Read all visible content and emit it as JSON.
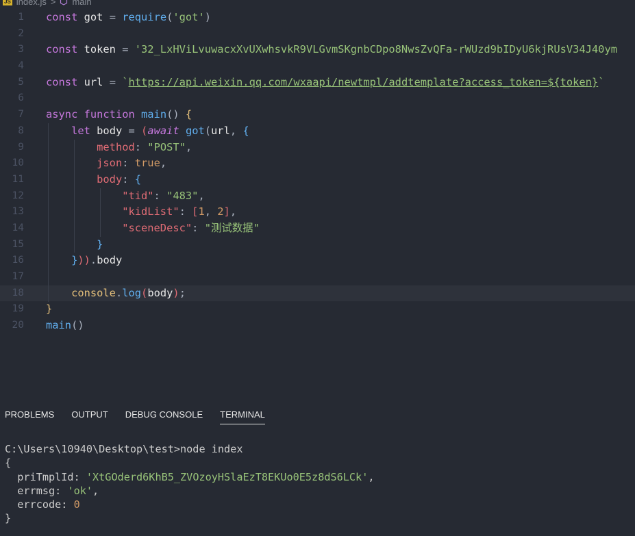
{
  "breadcrumb": {
    "file": "index.js",
    "symbol": "main",
    "separator": ">"
  },
  "editor": {
    "lines": [
      {
        "n": "1",
        "tokens": [
          [
            "k",
            "const "
          ],
          [
            "v",
            "got "
          ],
          [
            "p",
            "= "
          ],
          [
            "f",
            "require"
          ],
          [
            "p",
            "("
          ],
          [
            "s",
            "'got'"
          ],
          [
            "p",
            ")"
          ]
        ]
      },
      {
        "n": "2",
        "tokens": []
      },
      {
        "n": "3",
        "tokens": [
          [
            "k",
            "const "
          ],
          [
            "v",
            "token "
          ],
          [
            "p",
            "= "
          ],
          [
            "s",
            "'32_LxHViLvuwacxXvUXwhsvkR9VLGvmSKgnbCDpo8NwsZvQFa-rWUzd9bIDyU6kjRUsV34J40ym"
          ]
        ]
      },
      {
        "n": "4",
        "tokens": []
      },
      {
        "n": "5",
        "tokens": [
          [
            "k",
            "const "
          ],
          [
            "v",
            "url "
          ],
          [
            "p",
            "= "
          ],
          [
            "s",
            "`"
          ],
          [
            "url",
            "https://api.weixin.qq.com/wxaapi/newtmpl/addtemplate?access_token=${token}"
          ],
          [
            "s",
            "`"
          ]
        ]
      },
      {
        "n": "6",
        "tokens": []
      },
      {
        "n": "7",
        "tokens": [
          [
            "k",
            "async "
          ],
          [
            "k",
            "function "
          ],
          [
            "f",
            "main"
          ],
          [
            "p",
            "() "
          ],
          [
            "y",
            "{"
          ]
        ]
      },
      {
        "n": "8",
        "tokens": [
          [
            "p",
            "    "
          ],
          [
            "k",
            "let "
          ],
          [
            "v",
            "body "
          ],
          [
            "p",
            "= "
          ],
          [
            "pr",
            "("
          ],
          [
            "k it",
            "await "
          ],
          [
            "f",
            "got"
          ],
          [
            "p",
            "("
          ],
          [
            "v",
            "url"
          ],
          [
            "p",
            ", "
          ],
          [
            "f",
            "{"
          ]
        ]
      },
      {
        "n": "9",
        "tokens": [
          [
            "p",
            "        "
          ],
          [
            "pr",
            "method"
          ],
          [
            "p",
            ": "
          ],
          [
            "s",
            "\"POST\""
          ],
          [
            "p",
            ","
          ]
        ]
      },
      {
        "n": "10",
        "tokens": [
          [
            "p",
            "        "
          ],
          [
            "pr",
            "json"
          ],
          [
            "p",
            ": "
          ],
          [
            "n",
            "true"
          ],
          [
            "p",
            ","
          ]
        ]
      },
      {
        "n": "11",
        "tokens": [
          [
            "p",
            "        "
          ],
          [
            "pr",
            "body"
          ],
          [
            "p",
            ": "
          ],
          [
            "f",
            "{"
          ]
        ]
      },
      {
        "n": "12",
        "tokens": [
          [
            "p",
            "            "
          ],
          [
            "pr",
            "\"tid\""
          ],
          [
            "p",
            ": "
          ],
          [
            "s",
            "\"483\""
          ],
          [
            "p",
            ","
          ]
        ]
      },
      {
        "n": "13",
        "tokens": [
          [
            "p",
            "            "
          ],
          [
            "pr",
            "\"kidList\""
          ],
          [
            "p",
            ": "
          ],
          [
            "pr",
            "["
          ],
          [
            "n",
            "1"
          ],
          [
            "p",
            ", "
          ],
          [
            "n",
            "2"
          ],
          [
            "pr",
            "]"
          ],
          [
            "p",
            ","
          ]
        ]
      },
      {
        "n": "14",
        "tokens": [
          [
            "p",
            "            "
          ],
          [
            "pr",
            "\"sceneDesc\""
          ],
          [
            "p",
            ": "
          ],
          [
            "s",
            "\"测试数据\""
          ]
        ]
      },
      {
        "n": "15",
        "tokens": [
          [
            "p",
            "        "
          ],
          [
            "f",
            "}"
          ]
        ]
      },
      {
        "n": "16",
        "tokens": [
          [
            "p",
            "    "
          ],
          [
            "f",
            "}"
          ],
          [
            "pr",
            "))"
          ],
          [
            "p",
            "."
          ],
          [
            "v",
            "body"
          ]
        ]
      },
      {
        "n": "17",
        "tokens": []
      },
      {
        "n": "18",
        "tokens": [
          [
            "p",
            "    "
          ],
          [
            "y",
            "console"
          ],
          [
            "p",
            "."
          ],
          [
            "f",
            "log"
          ],
          [
            "pr",
            "("
          ],
          [
            "v",
            "body"
          ],
          [
            "pr",
            ")"
          ],
          [
            "p",
            ";"
          ]
        ]
      },
      {
        "n": "19",
        "tokens": [
          [
            "y",
            "}"
          ]
        ]
      },
      {
        "n": "20",
        "tokens": [
          [
            "f",
            "main"
          ],
          [
            "p",
            "()"
          ]
        ]
      }
    ]
  },
  "panel": {
    "tabs": [
      {
        "label": "PROBLEMS",
        "active": false
      },
      {
        "label": "OUTPUT",
        "active": false
      },
      {
        "label": "DEBUG CONSOLE",
        "active": false
      },
      {
        "label": "TERMINAL",
        "active": true
      }
    ],
    "terminal": {
      "prompt_line": "C:\\Users\\10940\\Desktop\\test>node index",
      "open": "{",
      "priTmplId_key": "  priTmplId: ",
      "priTmplId_val": "'XtGOderd6KhB5_ZVOzoyHSlaEzT8EKUo0E5z8dS6LCk'",
      "priTmplId_tail": ",",
      "errmsg_key": "  errmsg: ",
      "errmsg_val": "'ok'",
      "errmsg_tail": ",",
      "errcode_key": "  errcode: ",
      "errcode_val": "0",
      "close": "}"
    }
  }
}
